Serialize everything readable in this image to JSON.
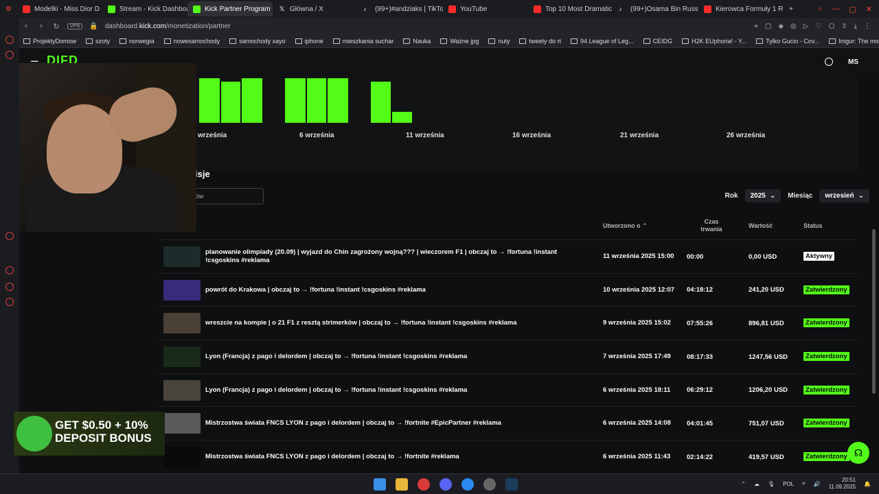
{
  "browser": {
    "tabs": [
      {
        "label": "Modelki - Miss Dior D",
        "icon": "youtube-icon",
        "active": false
      },
      {
        "label": "Stream - Kick Dashboard",
        "icon": "kick-icon",
        "active": false
      },
      {
        "label": "Kick Partner Program - K",
        "icon": "kick-icon",
        "active": true
      },
      {
        "label": "Główna / X",
        "icon": "x-icon",
        "active": false
      },
      {
        "label": "(99+)#andziaks | TikTok",
        "icon": "tiktok-icon",
        "active": false
      },
      {
        "label": "YouTube",
        "icon": "youtube-icon",
        "active": false
      },
      {
        "label": "Top 10 Most Dramatic M",
        "icon": "youtube-icon",
        "active": false
      },
      {
        "label": "(99+)Osama Bin Russell",
        "icon": "tiktok-icon",
        "active": false
      },
      {
        "label": "Kierowca Formuły 1 Robe",
        "icon": "youtube-icon",
        "active": false
      }
    ],
    "new_tab": "+",
    "vpn": "VPN",
    "url_prefix": "dashboard.",
    "url_host": "kick.com",
    "url_path": "/monetization/partner",
    "bookmarks": [
      "ProjektyDomow",
      "szoty",
      "norwegia",
      "nowesamochody",
      "samochody xayo",
      "iphone",
      "mieszkania suchar",
      "Nauka",
      "Ważne jpg",
      "nuty",
      "tweety do rt",
      "94 League of Leg...",
      "CEIDG",
      "H2K EUphoria! - Y...",
      "Tylko Gucio - Cov...",
      "Imgur: The most a..."
    ]
  },
  "header": {
    "logo": "DIFD",
    "avatar": "MS"
  },
  "chart_data": {
    "type": "bar",
    "x_tick_labels": [
      "września",
      "6 września",
      "11 września",
      "16 września",
      "21 września",
      "26 września"
    ]
  },
  "section": {
    "title": "isje",
    "search_value": "ytułów"
  },
  "filters": {
    "year_label": "Rok",
    "year_value": "2025",
    "month_label": "Miesiąc",
    "month_value": "wrzesień"
  },
  "table": {
    "headers": {
      "created": "Utworzono o",
      "duration": "Czas trwania",
      "value": "Wartość",
      "status": "Status"
    },
    "rows": [
      {
        "title": "planowanie olimpiady (20.09) | wyjazd do Chin zagrożony wojną??? | wieczorem F1 | obczaj to → !fortuna !instant !csgoskins #reklama",
        "created": "11 września 2025 15:00",
        "duration": "00:00",
        "value": "0,00 USD",
        "status": "Aktywny",
        "thumb": "#1d2c2a"
      },
      {
        "title": "powrót do Krakowa | obczaj to → !fortuna !instant !csgoskins #reklama",
        "created": "10 września 2025 12:07",
        "duration": "04:18:12",
        "value": "241,20 USD",
        "status": "Zatwierdzony",
        "thumb": "#3a2a7a"
      },
      {
        "title": "wreszcie na kompie | o 21 F1 z resztą strimerków | obczaj to → !fortuna !instant !csgoskins #reklama",
        "created": "9 września 2025 15:02",
        "duration": "07:55:26",
        "value": "896,81 USD",
        "status": "Zatwierdzony",
        "thumb": "#4a4036"
      },
      {
        "title": "Lyon (Francja) z pago i delordem | obczaj to → !fortuna !instant !csgoskins #reklama",
        "created": "7 września 2025 17:49",
        "duration": "08:17:33",
        "value": "1247,56 USD",
        "status": "Zatwierdzony",
        "thumb": "#1a2a1a"
      },
      {
        "title": "Lyon (Francja) z pago i delordem | obczaj to → !fortuna !instant !csgoskins #reklama",
        "created": "6 września 2025 18:11",
        "duration": "06:29:12",
        "value": "1206,20 USD",
        "status": "Zatwierdzony",
        "thumb": "#4a443e"
      },
      {
        "title": "Mistrzostwa świata FNCS LYON z pago i delordem | obczaj to → !fortnite #EpicPartner #reklama",
        "created": "6 września 2025 14:08",
        "duration": "04:01:45",
        "value": "751,07 USD",
        "status": "Zatwierdzony",
        "thumb": "#5a5a5a"
      },
      {
        "title": "Mistrzostwa świata FNCS LYON z pago i delordem | obczaj to → !fortnite #reklama",
        "created": "6 września 2025 11:43",
        "duration": "02:14:22",
        "value": "419,57 USD",
        "status": "Zatwierdzony",
        "thumb": "#0a0a0a"
      }
    ]
  },
  "ad": {
    "text": "GET $0.50 + 10% DEPOSIT BONUS"
  },
  "taskbar": {
    "lang": "POL",
    "time": "20:51",
    "date": "11.09.2025"
  },
  "colors": {
    "accent": "#53fc18"
  }
}
